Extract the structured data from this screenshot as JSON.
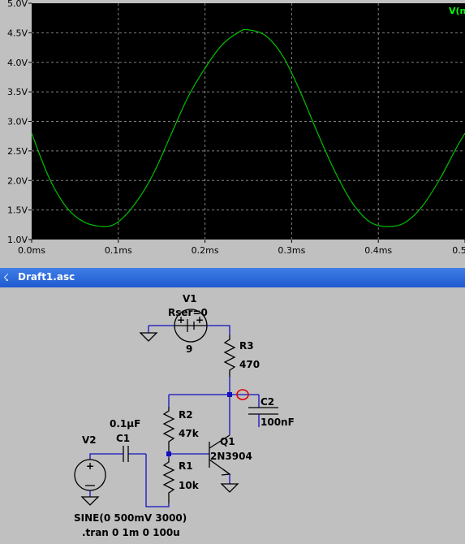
{
  "plot": {
    "trace_label": "V(n",
    "y_ticks": [
      "5.0V",
      "4.5V",
      "4.0V",
      "3.5V",
      "3.0V",
      "2.5V",
      "2.0V",
      "1.5V",
      "1.0V"
    ],
    "x_ticks": [
      "0.0ms",
      "0.1ms",
      "0.2ms",
      "0.3ms",
      "0.4ms",
      "0.5"
    ],
    "colors": {
      "background": "#000000",
      "trace": "#00c000",
      "grid": "#808080"
    }
  },
  "chart_data": {
    "type": "line",
    "xlabel": "",
    "ylabel": "",
    "xlim": [
      0,
      0.5
    ],
    "ylim": [
      1.0,
      5.0
    ],
    "x_units": "ms",
    "y_units": "V",
    "series": [
      {
        "name": "V(n",
        "x": [
          0.0,
          0.02,
          0.04,
          0.06,
          0.083,
          0.1,
          0.12,
          0.14,
          0.16,
          0.18,
          0.2,
          0.22,
          0.24,
          0.25,
          0.27,
          0.29,
          0.31,
          0.33,
          0.35,
          0.37,
          0.39,
          0.41,
          0.43,
          0.45,
          0.47,
          0.49,
          0.5
        ],
        "y": [
          2.8,
          2.05,
          1.55,
          1.3,
          1.22,
          1.3,
          1.62,
          2.1,
          2.75,
          3.4,
          3.9,
          4.3,
          4.52,
          4.55,
          4.45,
          4.1,
          3.5,
          2.8,
          2.15,
          1.62,
          1.3,
          1.22,
          1.28,
          1.55,
          2.0,
          2.55,
          2.8
        ]
      }
    ],
    "grid": true,
    "legend": "top-right"
  },
  "schematic": {
    "window_title": "Draft1.asc",
    "components": {
      "v1_name": "V1",
      "v1_param": "Rser=0",
      "v1_value": "9",
      "r3_name": "R3",
      "r3_value": "470",
      "c2_name": "C2",
      "c2_value": "100nF",
      "r2_name": "R2",
      "r2_value": "47k",
      "c1_value": "0.1µF",
      "c1_name": "C1",
      "v2_name": "V2",
      "q1_name": "Q1",
      "q1_value": "2N3904",
      "r1_name": "R1",
      "r1_value": "10k",
      "v2_value": "SINE(0 500mV 3000)",
      "directive": ".tran 0 1m 0 100u"
    },
    "colors": {
      "wire": "#1010c0",
      "probe": "#e00000",
      "junction": "#1010c0"
    }
  }
}
